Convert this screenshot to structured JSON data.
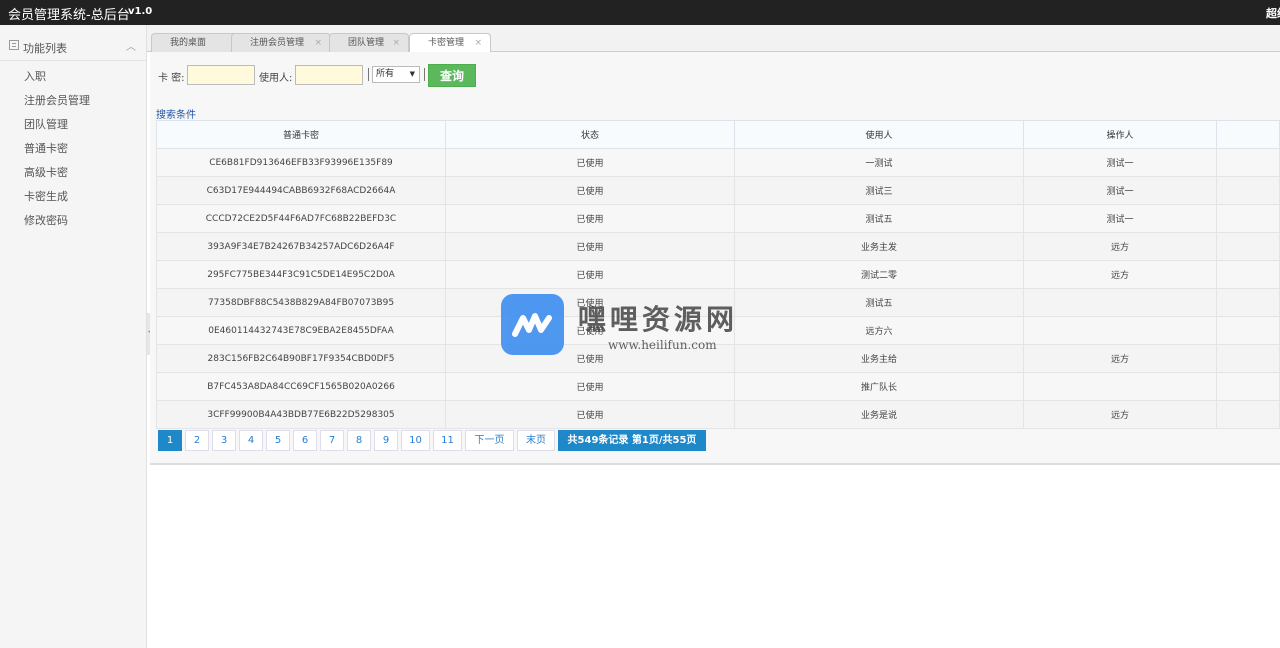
{
  "app": {
    "title": "会员管理系统-总后台",
    "version": "v1.0",
    "user": "超级"
  },
  "sidebar": {
    "header": "功能列表",
    "items": [
      {
        "label": "入职"
      },
      {
        "label": "注册会员管理"
      },
      {
        "label": "团队管理"
      },
      {
        "label": "普通卡密"
      },
      {
        "label": "高级卡密"
      },
      {
        "label": "卡密生成"
      },
      {
        "label": "修改密码"
      }
    ]
  },
  "tabs": [
    {
      "label": "我的桌面"
    },
    {
      "label": "注册会员管理"
    },
    {
      "label": "团队管理"
    },
    {
      "label": "卡密管理"
    }
  ],
  "search": {
    "card_label": "卡 密:",
    "card_value": "",
    "user_label": "使用人:",
    "user_value": "",
    "status_selected": "所有",
    "query_button": "查询",
    "conditions_link": "搜索条件"
  },
  "table": {
    "headers": [
      "普通卡密",
      "状态",
      "使用人",
      "操作人",
      ""
    ],
    "rows": [
      [
        "CE6B81FD913646EFB33F93996E135F89",
        "已使用",
        "一测试",
        "测试一",
        ""
      ],
      [
        "C63D17E944494CABB6932F68ACD2664A",
        "已使用",
        "测试三",
        "测试一",
        ""
      ],
      [
        "CCCD72CE2D5F44F6AD7FC68B22BEFD3C",
        "已使用",
        "测试五",
        "测试一",
        ""
      ],
      [
        "393A9F34E7B24267B34257ADC6D26A4F",
        "已使用",
        "业务主发",
        "远方",
        ""
      ],
      [
        "295FC775BE344F3C91C5DE14E95C2D0A",
        "已使用",
        "测试二零",
        "远方",
        ""
      ],
      [
        "77358DBF88C5438B829A84FB07073B95",
        "已使用",
        "测试五",
        "",
        ""
      ],
      [
        "0E460114432743E78C9EBA2E8455DFAA",
        "已使用",
        "远方六",
        "",
        ""
      ],
      [
        "283C156FB2C64B90BF17F9354CBD0DF5",
        "已使用",
        "业务主给",
        "远方",
        ""
      ],
      [
        "B7FC453A8DA84CC69CF1565B020A0266",
        "已使用",
        "推广队长",
        "",
        ""
      ],
      [
        "3CFF99900B4A43BDB77E6B22D5298305",
        "已使用",
        "业务是说",
        "远方",
        ""
      ]
    ]
  },
  "pager": {
    "pages": [
      "1",
      "2",
      "3",
      "4",
      "5",
      "6",
      "7",
      "8",
      "9",
      "10",
      "11"
    ],
    "next": "下一页",
    "last": "末页",
    "summary": "共549条记录 第1页/共55页"
  },
  "watermark": {
    "text": "嘿哩资源网",
    "url": "www.heilifun.com"
  }
}
